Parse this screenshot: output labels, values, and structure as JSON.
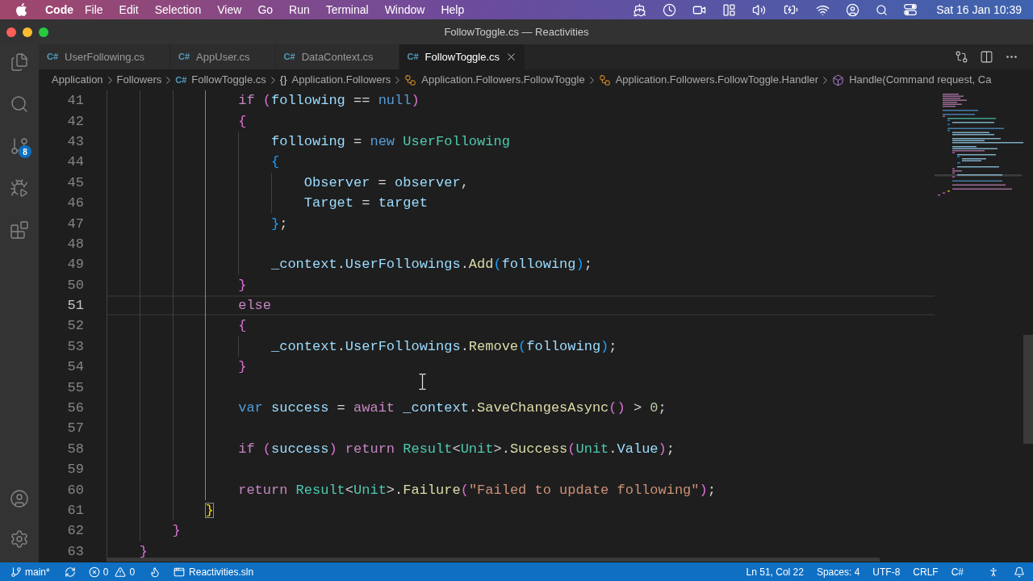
{
  "menu_bar": {
    "app_name": "Code",
    "menus": [
      "File",
      "Edit",
      "Selection",
      "View",
      "Go",
      "Run",
      "Terminal",
      "Window",
      "Help"
    ],
    "date_time": "Sat 16 Jan 10:39"
  },
  "window": {
    "title": "FollowToggle.cs — Reactivities"
  },
  "activity_bar": {
    "source_control_badge": "8"
  },
  "tabs": [
    {
      "icon": "C#",
      "label": "UserFollowing.cs",
      "selected": false
    },
    {
      "icon": "C#",
      "label": "AppUser.cs",
      "selected": false
    },
    {
      "icon": "C#",
      "label": "DataContext.cs",
      "selected": false
    },
    {
      "icon": "C#",
      "label": "FollowToggle.cs",
      "selected": true
    }
  ],
  "breadcrumbs": [
    {
      "kind": "folder",
      "label": "Application"
    },
    {
      "kind": "folder",
      "label": "Followers"
    },
    {
      "kind": "file",
      "icon": "C#",
      "label": "FollowToggle.cs"
    },
    {
      "kind": "namespace",
      "icon": "{}",
      "label": "Application.Followers"
    },
    {
      "kind": "class",
      "label": "Application.Followers.FollowToggle"
    },
    {
      "kind": "class",
      "label": "Application.Followers.FollowToggle.Handler"
    },
    {
      "kind": "method",
      "label": "Handle(Command request, Ca"
    }
  ],
  "editor": {
    "lines": [
      {
        "children": [
          {
            "children": [
              {
                "children": [
                  {
                    "children": [
                      {
                        "number": "41",
                        "current": false,
                        "tokens": [
                          {
                            "kind": "control",
                            "text": "if "
                          },
                          {
                            "kind": "bracket2",
                            "text": "("
                          },
                          {
                            "kind": "variable",
                            "text": "following"
                          },
                          {
                            "kind": "punct",
                            "text": " == "
                          },
                          {
                            "kind": "keyword",
                            "text": "null"
                          },
                          {
                            "kind": "bracket2",
                            "text": ")"
                          }
                        ]
                      },
                      {
                        "number": "42",
                        "current": false,
                        "tokens": [
                          {
                            "kind": "bracket2",
                            "text": "{"
                          }
                        ],
                        "children": [
                          {
                            "number": "43",
                            "current": false,
                            "tokens": [
                              {
                                "kind": "variable",
                                "text": "following"
                              },
                              {
                                "kind": "punct",
                                "text": " = "
                              },
                              {
                                "kind": "keyword",
                                "text": "new "
                              },
                              {
                                "kind": "type",
                                "text": "UserFollowing"
                              }
                            ]
                          },
                          {
                            "number": "44",
                            "current": false,
                            "tokens": [
                              {
                                "kind": "bracket3",
                                "text": "{"
                              }
                            ],
                            "children": [
                              {
                                "number": "45",
                                "current": false,
                                "tokens": [
                                  {
                                    "kind": "variable",
                                    "text": "Observer"
                                  },
                                  {
                                    "kind": "punct",
                                    "text": " = "
                                  },
                                  {
                                    "kind": "variable",
                                    "text": "observer"
                                  },
                                  {
                                    "kind": "punct",
                                    "text": ","
                                  }
                                ]
                              },
                              {
                                "number": "46",
                                "current": false,
                                "tokens": [
                                  {
                                    "kind": "variable",
                                    "text": "Target"
                                  },
                                  {
                                    "kind": "punct",
                                    "text": " = "
                                  },
                                  {
                                    "kind": "variable",
                                    "text": "target"
                                  }
                                ]
                              }
                            ]
                          },
                          {
                            "number": "47",
                            "current": false,
                            "tokens": [
                              {
                                "kind": "bracket3",
                                "text": "}"
                              },
                              {
                                "kind": "punct",
                                "text": ";"
                              }
                            ]
                          },
                          {
                            "number": "48",
                            "current": false
                          },
                          {
                            "number": "49",
                            "current": false,
                            "tokens": [
                              {
                                "kind": "variable",
                                "text": "_context"
                              },
                              {
                                "kind": "punct",
                                "text": "."
                              },
                              {
                                "kind": "variable",
                                "text": "UserFollowings"
                              },
                              {
                                "kind": "punct",
                                "text": "."
                              },
                              {
                                "kind": "method",
                                "text": "Add"
                              },
                              {
                                "kind": "bracket3",
                                "text": "("
                              },
                              {
                                "kind": "variable",
                                "text": "following"
                              },
                              {
                                "kind": "bracket3",
                                "text": ")"
                              },
                              {
                                "kind": "punct",
                                "text": ";"
                              }
                            ]
                          }
                        ]
                      },
                      {
                        "number": "50",
                        "current": false,
                        "tokens": [
                          {
                            "kind": "bracket2",
                            "text": "}"
                          }
                        ]
                      },
                      {
                        "number": "51",
                        "current": true,
                        "tokens": [
                          {
                            "kind": "control",
                            "text": "else"
                          }
                        ]
                      },
                      {
                        "number": "52",
                        "current": false,
                        "tokens": [
                          {
                            "kind": "bracket2",
                            "text": "{"
                          }
                        ],
                        "children": [
                          {
                            "number": "53",
                            "current": false,
                            "tokens": [
                              {
                                "kind": "variable",
                                "text": "_context"
                              },
                              {
                                "kind": "punct",
                                "text": "."
                              },
                              {
                                "kind": "variable",
                                "text": "UserFollowings"
                              },
                              {
                                "kind": "punct",
                                "text": "."
                              },
                              {
                                "kind": "method",
                                "text": "Remove"
                              },
                              {
                                "kind": "bracket3",
                                "text": "("
                              },
                              {
                                "kind": "variable",
                                "text": "following"
                              },
                              {
                                "kind": "bracket3",
                                "text": ")"
                              },
                              {
                                "kind": "punct",
                                "text": ";"
                              }
                            ]
                          }
                        ]
                      },
                      {
                        "number": "54",
                        "current": false,
                        "tokens": [
                          {
                            "kind": "bracket2",
                            "text": "}"
                          }
                        ]
                      },
                      {
                        "number": "55",
                        "current": false
                      },
                      {
                        "number": "56",
                        "current": false,
                        "tokens": [
                          {
                            "kind": "keyword",
                            "text": "var "
                          },
                          {
                            "kind": "variable",
                            "text": "success"
                          },
                          {
                            "kind": "punct",
                            "text": " = "
                          },
                          {
                            "kind": "control",
                            "text": "await "
                          },
                          {
                            "kind": "variable",
                            "text": "_context"
                          },
                          {
                            "kind": "punct",
                            "text": "."
                          },
                          {
                            "kind": "method",
                            "text": "SaveChangesAsync"
                          },
                          {
                            "kind": "bracket2",
                            "text": "()"
                          },
                          {
                            "kind": "punct",
                            "text": " > "
                          },
                          {
                            "kind": "number",
                            "text": "0"
                          },
                          {
                            "kind": "punct",
                            "text": ";"
                          }
                        ]
                      },
                      {
                        "number": "57",
                        "current": false
                      },
                      {
                        "number": "58",
                        "current": false,
                        "tokens": [
                          {
                            "kind": "control",
                            "text": "if "
                          },
                          {
                            "kind": "bracket2",
                            "text": "("
                          },
                          {
                            "kind": "variable",
                            "text": "success"
                          },
                          {
                            "kind": "bracket2",
                            "text": ") "
                          },
                          {
                            "kind": "control",
                            "text": "return "
                          },
                          {
                            "kind": "type",
                            "text": "Result"
                          },
                          {
                            "kind": "punct",
                            "text": "<"
                          },
                          {
                            "kind": "type",
                            "text": "Unit"
                          },
                          {
                            "kind": "punct",
                            "text": ">."
                          },
                          {
                            "kind": "method",
                            "text": "Success"
                          },
                          {
                            "kind": "bracket2",
                            "text": "("
                          },
                          {
                            "kind": "type",
                            "text": "Unit"
                          },
                          {
                            "kind": "punct",
                            "text": "."
                          },
                          {
                            "kind": "variable",
                            "text": "Value"
                          },
                          {
                            "kind": "bracket2",
                            "text": ")"
                          },
                          {
                            "kind": "punct",
                            "text": ";"
                          }
                        ]
                      },
                      {
                        "number": "59",
                        "current": false
                      },
                      {
                        "number": "60",
                        "current": false,
                        "tokens": [
                          {
                            "kind": "control",
                            "text": "return "
                          },
                          {
                            "kind": "type",
                            "text": "Result"
                          },
                          {
                            "kind": "punct",
                            "text": "<"
                          },
                          {
                            "kind": "type",
                            "text": "Unit"
                          },
                          {
                            "kind": "punct",
                            "text": ">."
                          },
                          {
                            "kind": "method",
                            "text": "Failure"
                          },
                          {
                            "kind": "bracket2",
                            "text": "("
                          },
                          {
                            "kind": "string",
                            "text": "\"Failed to update following\""
                          },
                          {
                            "kind": "bracket2",
                            "text": ")"
                          },
                          {
                            "kind": "punct",
                            "text": ";"
                          }
                        ]
                      }
                    ]
                  },
                  {
                    "number": "61",
                    "current": false,
                    "tokens": [
                      {
                        "kind": "match",
                        "text": "}"
                      }
                    ]
                  }
                ]
              },
              {
                "number": "62",
                "current": false,
                "tokens": [
                  {
                    "kind": "bracket2",
                    "text": "}"
                  }
                ]
              }
            ]
          },
          {
            "number": "63",
            "current": false,
            "tokens": [
              {
                "kind": "bracket2",
                "text": "}"
              }
            ]
          }
        ]
      }
    ]
  },
  "status_bar": {
    "branch": "main*",
    "errors": "0",
    "warnings": "0",
    "solution": "Reactivities.sln",
    "cursor_position": "Ln 51, Col 22",
    "indentation": "Spaces: 4",
    "encoding": "UTF-8",
    "line_ending": "CRLF",
    "language": "C#"
  }
}
